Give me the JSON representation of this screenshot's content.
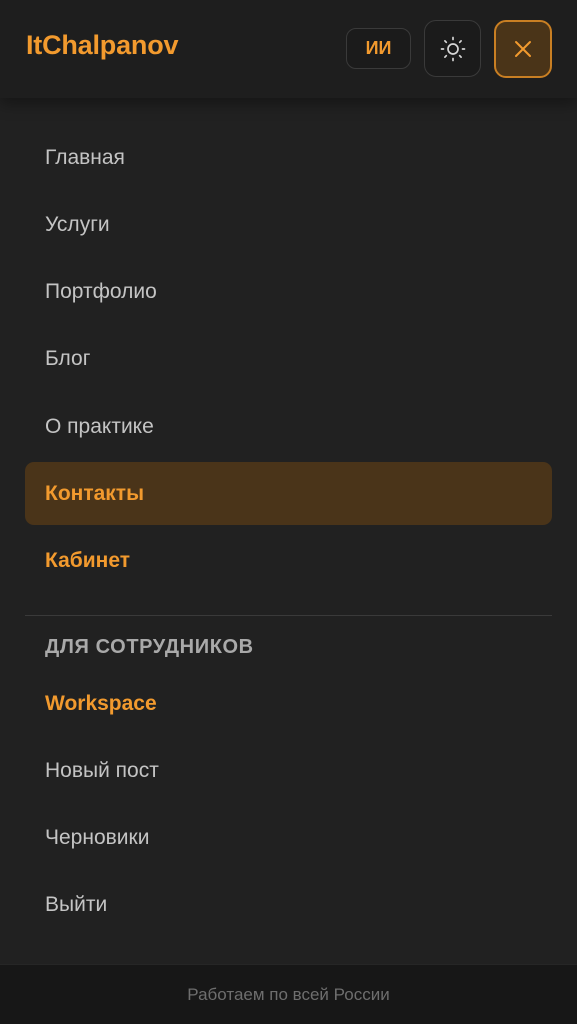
{
  "header": {
    "logo": "ItChalpanov",
    "ai_label": "ИИ",
    "theme_icon": "sun-icon",
    "close_icon": "close-icon"
  },
  "menu": {
    "items": [
      {
        "label": "Главная"
      },
      {
        "label": "Услуги"
      },
      {
        "label": "Портфолио"
      },
      {
        "label": "Блог"
      },
      {
        "label": "О практике"
      },
      {
        "label": "Контакты",
        "active": true
      },
      {
        "label": "Кабинет"
      }
    ]
  },
  "staff": {
    "heading": "ДЛЯ СОТРУДНИКОВ",
    "items": [
      {
        "label": "Workspace"
      },
      {
        "label": "Новый пост"
      },
      {
        "label": "Черновики"
      },
      {
        "label": "Выйти"
      }
    ]
  },
  "footer": {
    "text": "Работаем по всей России"
  },
  "colors": {
    "accent": "#f29a2e",
    "background": "#212121",
    "active_bg": "#4a3419"
  }
}
